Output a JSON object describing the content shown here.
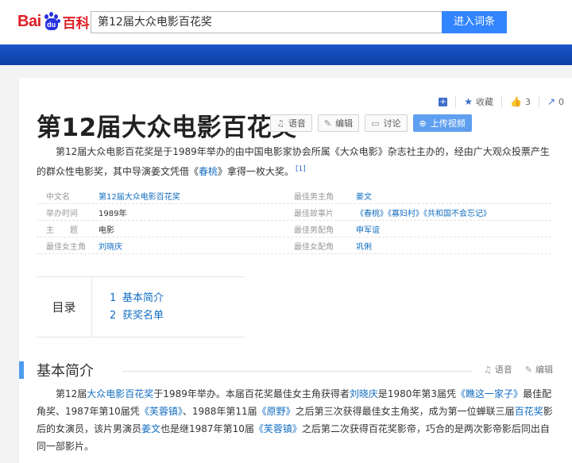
{
  "logo": {
    "bai": "Bai",
    "du": "du",
    "baike": "百科"
  },
  "search": {
    "value": "第12届大众电影百花奖",
    "button": "进入词条"
  },
  "ops": {
    "favorite": "收藏",
    "like_count": "3",
    "share_count": "0"
  },
  "title": "第12届大众电影百花奖",
  "tools": {
    "voice": "语音",
    "edit": "编辑",
    "discuss": "讨论",
    "upload": "上传视频"
  },
  "summary": {
    "p1": "第12届大众电影百花奖是于1989年举办的由中国电影家协会所属《大众电影》杂志社主办的，经由广大观众投票产生的群众性电影奖，其中导演姜文凭借《",
    "link": "春桃",
    "p2": "》拿得一枚大奖。",
    "ref": "[1]"
  },
  "basic_info": {
    "left": [
      {
        "k": "中文名",
        "v": "第12届大众电影百花奖",
        "link": true
      },
      {
        "k": "举办时间",
        "v": "1989年",
        "link": false
      },
      {
        "k": "主　　题",
        "v": "电影",
        "link": false
      },
      {
        "k": "最佳女主角",
        "v": "刘晓庆",
        "link": true
      }
    ],
    "right": [
      {
        "k": "最佳男主角",
        "v": "姜文",
        "link": true
      },
      {
        "k": "最佳故事片",
        "v": "《春桃》《寡妇村》《共和国不会忘记》",
        "link": true
      },
      {
        "k": "最佳男配角",
        "v": "申军谊",
        "link": true
      },
      {
        "k": "最佳女配角",
        "v": "巩俐",
        "link": true
      }
    ]
  },
  "toc": {
    "label": "目录",
    "items": [
      {
        "n": "1",
        "label": "基本简介"
      },
      {
        "n": "2",
        "label": "获奖名单"
      }
    ]
  },
  "section": {
    "title": "基本简介",
    "voice": "语音",
    "edit": "编辑"
  },
  "paragraph": {
    "t1": "第12届",
    "l1": "大众电影百花奖",
    "t2": "于1989年举办。本届百花奖最佳女主角获得者",
    "l2": "刘晓庆",
    "t3": "是1980年第3届凭",
    "l3": "《瞧这一家子》",
    "t4": "最佳配角奖、1987年第10届凭",
    "l4": "《芙蓉镇》",
    "t5": "、1988年第11届",
    "l5": "《原野》",
    "t6": "之后第三次获得最佳女主角奖，成为第一位蝉联三届",
    "l6": "百花奖",
    "t7": "影后的女演员，该片男演员",
    "l7": "姜文",
    "t8": "也是继1987年第10届",
    "l8": "《芙蓉镇》",
    "t9": "之后第二次获得百花奖影帝，巧合的是两次影帝影后同出自同一部影片。"
  }
}
